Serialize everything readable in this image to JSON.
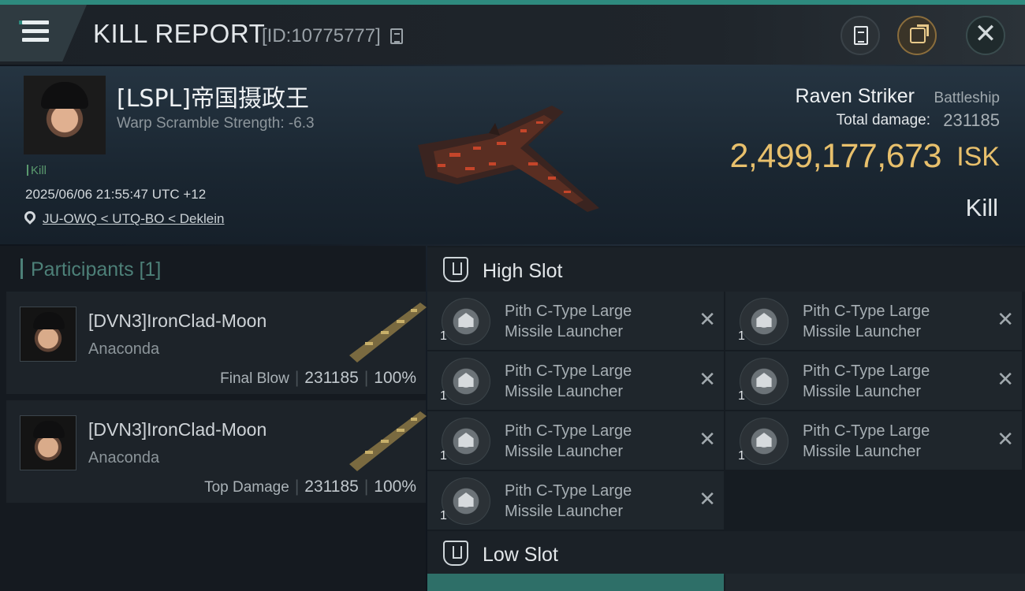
{
  "header": {
    "title": "KILL REPORT",
    "report_id": "[ID:10775777]"
  },
  "victim": {
    "name": "[LSPL]帝国摄政王",
    "warp_scramble": "Warp Scramble Strength: -6.3",
    "tag": "Kill",
    "timestamp": "2025/06/06 21:55:47 UTC +12",
    "location": "JU-OWQ < UTQ-BO < Deklein",
    "ship_name": "Raven Striker",
    "ship_class": "Battleship",
    "total_damage_label": "Total damage:",
    "total_damage": "231185",
    "isk_value": "2,499,177,673",
    "isk_unit": "ISK",
    "result": "Kill"
  },
  "participants": {
    "heading": "Participants [1]",
    "items": [
      {
        "name": "[DVN3]IronClad-Moon",
        "ship": "Anaconda",
        "role": "Final Blow",
        "damage": "231185",
        "percent": "100%"
      },
      {
        "name": "[DVN3]IronClad-Moon",
        "ship": "Anaconda",
        "role": "Top Damage",
        "damage": "231185",
        "percent": "100%"
      }
    ]
  },
  "fittings": {
    "high_slot_title": "High Slot",
    "low_slot_title": "Low Slot",
    "high_modules": [
      {
        "line1": "Pith C-Type Large",
        "line2": "Missile Launcher",
        "qty": "1"
      },
      {
        "line1": "Pith C-Type Large",
        "line2": "Missile Launcher",
        "qty": "1"
      },
      {
        "line1": "Pith C-Type Large",
        "line2": "Missile Launcher",
        "qty": "1"
      },
      {
        "line1": "Pith C-Type Large",
        "line2": "Missile Launcher",
        "qty": "1"
      },
      {
        "line1": "Pith C-Type Large",
        "line2": "Missile Launcher",
        "qty": "1"
      },
      {
        "line1": "Pith C-Type Large",
        "line2": "Missile Launcher",
        "qty": "1"
      },
      {
        "line1": "Pith C-Type Large",
        "line2": "Missile Launcher",
        "qty": "1"
      }
    ]
  },
  "icons": {
    "menu": "hamburger-icon",
    "copy": "copy-icon",
    "doc": "document-icon",
    "share": "share-icon",
    "close": "close-icon",
    "location": "location-pin-icon",
    "slot": "slot-icon"
  },
  "colors": {
    "accent": "#2e8a7e",
    "isk": "#e8c06c",
    "kill_tag": "#5a9a6e"
  }
}
